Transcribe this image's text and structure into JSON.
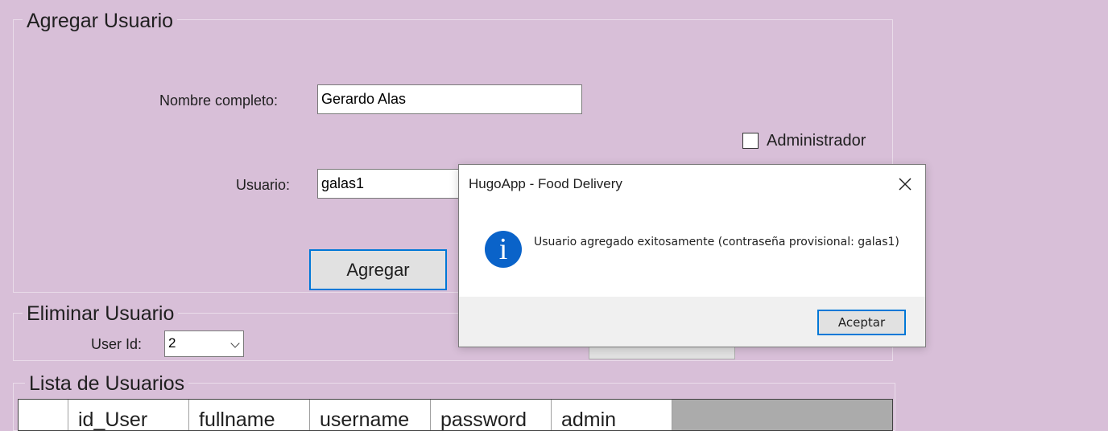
{
  "add_user": {
    "title": "Agregar Usuario",
    "fullname_label": "Nombre completo:",
    "fullname_value": "Gerardo Alas",
    "admin_label": "Administrador",
    "admin_checked": false,
    "username_label": "Usuario:",
    "username_value": "galas1",
    "add_button": "Agregar"
  },
  "delete_user": {
    "title": "Eliminar Usuario",
    "userid_label": "User Id:",
    "userid_value": "2"
  },
  "user_list": {
    "title": "Lista de Usuarios",
    "columns": [
      "id_User",
      "fullname",
      "username",
      "password",
      "admin"
    ]
  },
  "dialog": {
    "title": "HugoApp - Food Delivery",
    "icon": "info-icon",
    "message": "Usuario agregado exitosamente (contraseña provisional: galas1)",
    "ok_button": "Aceptar"
  },
  "colors": {
    "background": "#d8bfd8",
    "focus_accent": "#0078d7",
    "info_icon": "#0a63c9"
  }
}
